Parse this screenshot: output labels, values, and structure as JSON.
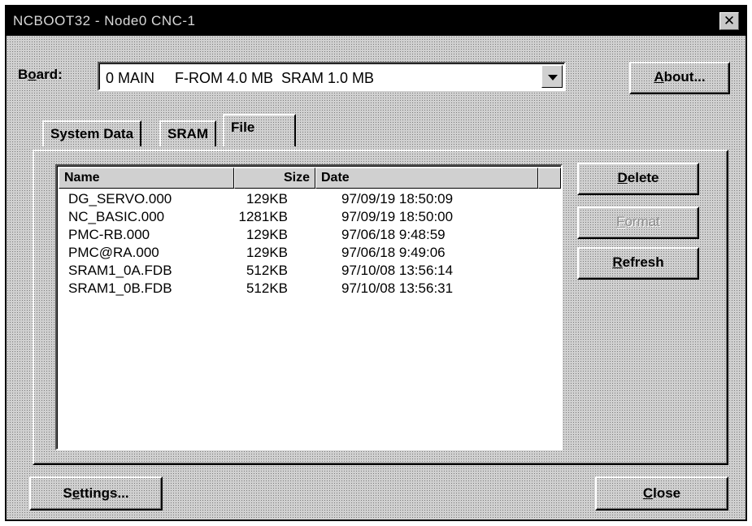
{
  "window": {
    "title": "NCBOOT32 - Node0  CNC-1",
    "close_glyph": "✕"
  },
  "board": {
    "label_prefix": "B",
    "label_underline": "o",
    "label_suffix": "ard:",
    "selected": "0 MAIN     F-ROM 4.0 MB  SRAM 1.0 MB"
  },
  "about_button": {
    "underline": "A",
    "rest": "bout..."
  },
  "tabs": [
    {
      "label": "System Data"
    },
    {
      "label": "SRAM"
    },
    {
      "label": "File"
    }
  ],
  "file_list": {
    "headers": {
      "name": "Name",
      "size": "Size",
      "date": "Date"
    },
    "rows": [
      {
        "name": "DG_SERVO.000",
        "size": "129KB",
        "date": "97/09/19 18:50:09"
      },
      {
        "name": "NC_BASIC.000",
        "size": "1281KB",
        "date": "97/09/19 18:50:00"
      },
      {
        "name": "PMC-RB.000",
        "size": "129KB",
        "date": "97/06/18 9:48:59"
      },
      {
        "name": "PMC@RA.000",
        "size": "129KB",
        "date": "97/06/18 9:49:06"
      },
      {
        "name": "SRAM1_0A.FDB",
        "size": "512KB",
        "date": "97/10/08 13:56:14"
      },
      {
        "name": "SRAM1_0B.FDB",
        "size": "512KB",
        "date": "97/10/08 13:56:31"
      }
    ]
  },
  "actions": {
    "delete": {
      "underline": "D",
      "rest": "elete"
    },
    "format": {
      "underline": "F",
      "rest": "ormat"
    },
    "refresh": {
      "underline": "R",
      "rest": "efresh"
    }
  },
  "settings_button": {
    "prefix": "S",
    "underline": "e",
    "rest": "ttings..."
  },
  "close_button": {
    "underline": "C",
    "rest": "lose"
  }
}
